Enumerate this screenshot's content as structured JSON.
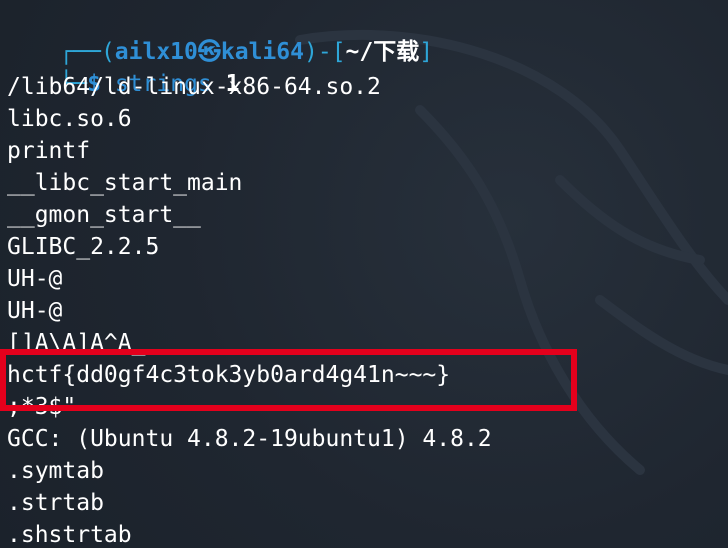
{
  "prompt": {
    "corner_top": "┌──",
    "open_paren": "(",
    "user_host": "ailx10㉿kali64",
    "close_paren": ")",
    "dash": "-",
    "open_bracket": "[",
    "cwd": "~/下载",
    "close_bracket": "]",
    "corner_bottom": "└─",
    "dollar": "$",
    "command": "strings",
    "argument": "1"
  },
  "output_lines": [
    "/lib64/ld-linux-x86-64.so.2",
    "libc.so.6",
    "printf",
    "__libc_start_main",
    "__gmon_start__",
    "GLIBC_2.2.5",
    "UH-@",
    "UH-@",
    "[]A\\A]A^A_",
    "hctf{dd0gf4c3tok3yb0ard4g41n~~~}",
    ";*3$\"",
    "GCC: (Ubuntu 4.8.2-19ubuntu1) 4.8.2",
    ".symtab",
    ".strtab",
    ".shstrtab"
  ],
  "highlighted_line": "hctf{dd0gf4c3tok3yb0ard4g41n~~~}",
  "colors": {
    "background": "#1f2630",
    "prompt_accent": "#2ea6d8",
    "highlight_border": "#e4001c",
    "text": "#ffffff"
  }
}
